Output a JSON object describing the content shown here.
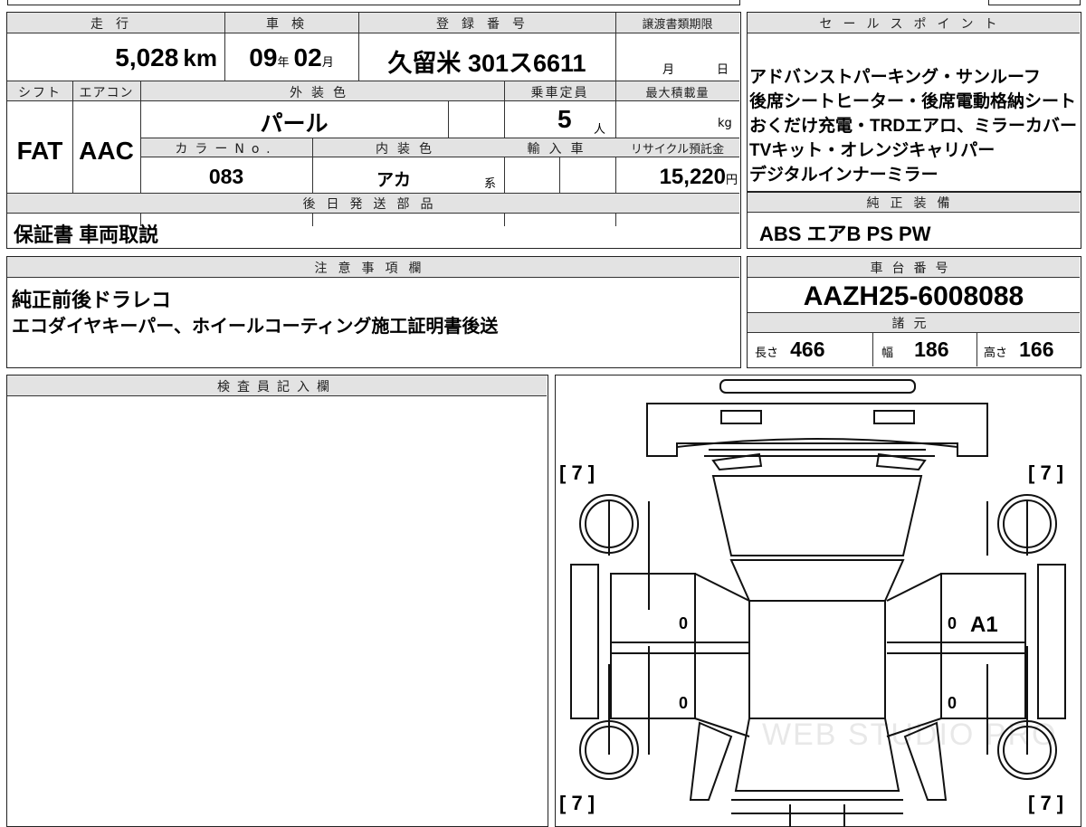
{
  "vehicle": {
    "mileage_label": "走行",
    "mileage_value": "5,028",
    "mileage_unit": "km",
    "inspection_label": "車検",
    "inspection_year": "09",
    "inspection_year_unit": "年",
    "inspection_month": "02",
    "inspection_month_unit": "月",
    "registration_label": "登録番号",
    "registration_value": "久留米 301ス6611",
    "transfer_deadline_label": "譲渡書類期限",
    "transfer_month_unit": "月",
    "transfer_day_unit": "日",
    "shift_label": "シフト",
    "shift_value": "FAT",
    "aircon_label": "エアコン",
    "aircon_value": "AAC",
    "exterior_color_label": "外装色",
    "exterior_color_value": "パール",
    "capacity_label": "乗車定員",
    "capacity_value": "5",
    "capacity_unit": "人",
    "max_load_label": "最大積載量",
    "max_load_unit": "kg",
    "color_no_label": "カラーNo.",
    "color_no_value": "083",
    "interior_color_label": "内装色",
    "interior_color_value": "アカ",
    "interior_color_suffix": "系",
    "import_label": "輸入車",
    "recycle_label": "リサイクル預託金",
    "recycle_value": "15,220",
    "recycle_unit": "円"
  },
  "sales_points": {
    "title": "セールスポイント",
    "lines": [
      "アドバンストパーキング・サンルーフ",
      "後席シートヒーター・後席電動格納シート",
      "おくだけ充電・TRDエアロ、ミラーカバー",
      "TVキット・オレンジキャリパー",
      "デジタルインナーミラー"
    ]
  },
  "later_parts": {
    "title": "後日発送部品",
    "value": "保証書 車両取説"
  },
  "genuine_equipment": {
    "title": "純正装備",
    "value": "ABS エアB PS PW"
  },
  "notes": {
    "title": "注意事項欄",
    "lines": [
      "純正前後ドラレコ",
      "エコダイヤキーパー、ホイールコーティング施工証明書後送"
    ]
  },
  "chassis": {
    "title": "車台番号",
    "value": "AAZH25-6008088"
  },
  "specs": {
    "title": "諸元",
    "length_label": "長さ",
    "length_value": "466",
    "width_label": "幅",
    "width_value": "186",
    "height_label": "高さ",
    "height_value": "166"
  },
  "inspector": {
    "title": "検査員記入欄"
  },
  "diagram": {
    "bracket_tl": "[ 7 ]",
    "bracket_tr": "[ 7 ]",
    "bracket_bl": "[ 7 ]",
    "bracket_br": "[ 7 ]",
    "door_fl": "0",
    "door_fr": "0",
    "door_rl": "0",
    "door_rr": "0",
    "damage_code": "A1",
    "watermark": "WEB STUDIO PRO"
  }
}
